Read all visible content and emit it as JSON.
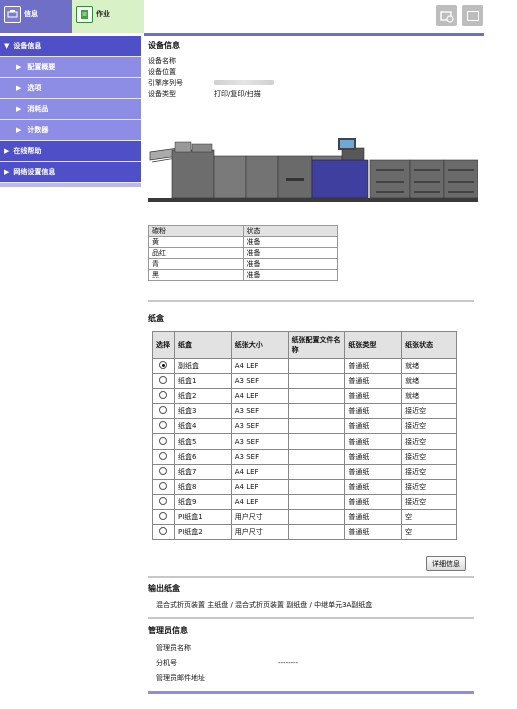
{
  "tabs": {
    "info_label": "信息",
    "job_label": "作业"
  },
  "sidebar": {
    "items": [
      {
        "label": "设备信息",
        "level": 1,
        "arrow": "▼"
      },
      {
        "label": "配置概要",
        "level": 2,
        "arrow": "▶"
      },
      {
        "label": "选项",
        "level": 2,
        "arrow": "▶"
      },
      {
        "label": "消耗品",
        "level": 2,
        "arrow": "▶"
      },
      {
        "label": "计数器",
        "level": 2,
        "arrow": "▶"
      },
      {
        "label": "在线帮助",
        "level": 1,
        "arrow": "▶"
      },
      {
        "label": "网络设置信息",
        "level": 1,
        "arrow": "▶"
      }
    ]
  },
  "device": {
    "title": "设备信息",
    "name_label": "设备名称",
    "location_label": "设备位置",
    "serial_label": "引擎序列号",
    "type_label": "设备类型",
    "type_value": "打印/复印/扫描"
  },
  "toner": {
    "headers": [
      "碳粉",
      "状态"
    ],
    "rows": [
      [
        "黄",
        "准备"
      ],
      [
        "品红",
        "准备"
      ],
      [
        "青",
        "准备"
      ],
      [
        "黑",
        "准备"
      ]
    ]
  },
  "trays": {
    "title": "纸盒",
    "headers": [
      "选择",
      "纸盒",
      "纸张大小",
      "纸张配置文件名称",
      "纸张类型",
      "纸张状态"
    ],
    "rows": [
      {
        "selected": true,
        "tray": "副纸盒",
        "size": "A4 LEF",
        "profile": "",
        "type": "普通纸",
        "status": "就绪"
      },
      {
        "selected": false,
        "tray": "纸盒1",
        "size": "A3 SEF",
        "profile": "",
        "type": "普通纸",
        "status": "就绪"
      },
      {
        "selected": false,
        "tray": "纸盒2",
        "size": "A4 LEF",
        "profile": "",
        "type": "普通纸",
        "status": "就绪"
      },
      {
        "selected": false,
        "tray": "纸盒3",
        "size": "A3 SEF",
        "profile": "",
        "type": "普通纸",
        "status": "接近空"
      },
      {
        "selected": false,
        "tray": "纸盒4",
        "size": "A3 SEF",
        "profile": "",
        "type": "普通纸",
        "status": "接近空"
      },
      {
        "selected": false,
        "tray": "纸盒5",
        "size": "A3 SEF",
        "profile": "",
        "type": "普通纸",
        "status": "接近空"
      },
      {
        "selected": false,
        "tray": "纸盒6",
        "size": "A3 SEF",
        "profile": "",
        "type": "普通纸",
        "status": "接近空"
      },
      {
        "selected": false,
        "tray": "纸盒7",
        "size": "A4 LEF",
        "profile": "",
        "type": "普通纸",
        "status": "接近空"
      },
      {
        "selected": false,
        "tray": "纸盒8",
        "size": "A4 LEF",
        "profile": "",
        "type": "普通纸",
        "status": "接近空"
      },
      {
        "selected": false,
        "tray": "纸盒9",
        "size": "A4 LEF",
        "profile": "",
        "type": "普通纸",
        "status": "接近空"
      },
      {
        "selected": false,
        "tray": "PI纸盒1",
        "size": "用户尺寸",
        "profile": "",
        "type": "普通纸",
        "status": "空"
      },
      {
        "selected": false,
        "tray": "PI纸盒2",
        "size": "用户尺寸",
        "profile": "",
        "type": "普通纸",
        "status": "空"
      }
    ],
    "detail_button": "详细信息"
  },
  "output": {
    "title": "输出纸盒",
    "text": "混合式折页装置 主纸盘 / 混合式折页装置 副纸盘 / 中继单元3A副纸盒"
  },
  "admin": {
    "title": "管理员信息",
    "name_label": "管理员名称",
    "ext_label": "分机号",
    "ext_value": "--------",
    "email_label": "管理员邮件地址"
  },
  "colors": {
    "primary": "#4f4fc7",
    "secondary": "#8d8de6",
    "job_tab": "#d8f1c7",
    "machine_accent": "#3f3f9f"
  }
}
